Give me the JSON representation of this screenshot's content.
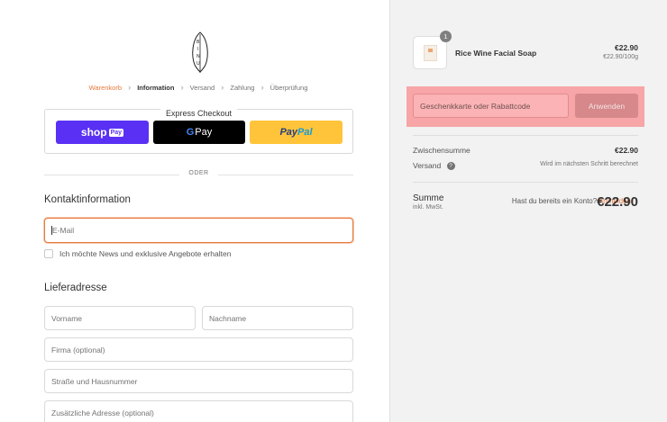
{
  "brand": {
    "logo_text": "BINU"
  },
  "breadcrumb": {
    "cart": "Warenkorb",
    "information": "Information",
    "shipping": "Versand",
    "payment": "Zahlung",
    "review": "Überprüfung",
    "separator": "›"
  },
  "express": {
    "title": "Express Checkout",
    "shop_label": "shop",
    "shop_badge": "Pay",
    "gpay_g": "G",
    "gpay_label": "Pay",
    "paypal_p1": "Pay",
    "paypal_p2": "Pal"
  },
  "divider_text": "ODER",
  "contact": {
    "title": "Kontaktinformation",
    "login_prompt": "Hast du bereits ein Konto?",
    "login_link": "Anmelden",
    "email_placeholder": "E-Mail",
    "newsletter_label": "Ich möchte News und exklusive Angebote erhalten"
  },
  "shipping_address": {
    "title": "Lieferadresse",
    "first_name": "Vorname",
    "last_name": "Nachname",
    "company": "Firma (optional)",
    "street": "Straße und Hausnummer",
    "address2": "Zusätzliche Adresse (optional)"
  },
  "summary": {
    "product": {
      "quantity": "1",
      "name": "Rice Wine Facial Soap",
      "price": "€22.90",
      "unit_price": "€22.90/100g"
    },
    "discount_placeholder": "Geschenkkarte oder Rabattcode",
    "apply_label": "Anwenden",
    "subtotal_label": "Zwischensumme",
    "subtotal_value": "€22.90",
    "shipping_label": "Versand",
    "shipping_help": "?",
    "shipping_value": "Wird im nächsten Schritt berechnet",
    "total_label": "Summe",
    "total_tax": "inkl. MwSt.",
    "total_value": "€22.90"
  },
  "colors": {
    "accent": "#e8783d",
    "shop_pay": "#5a31f4",
    "paypal": "#ffc439",
    "highlight": "#f7a5a7"
  }
}
